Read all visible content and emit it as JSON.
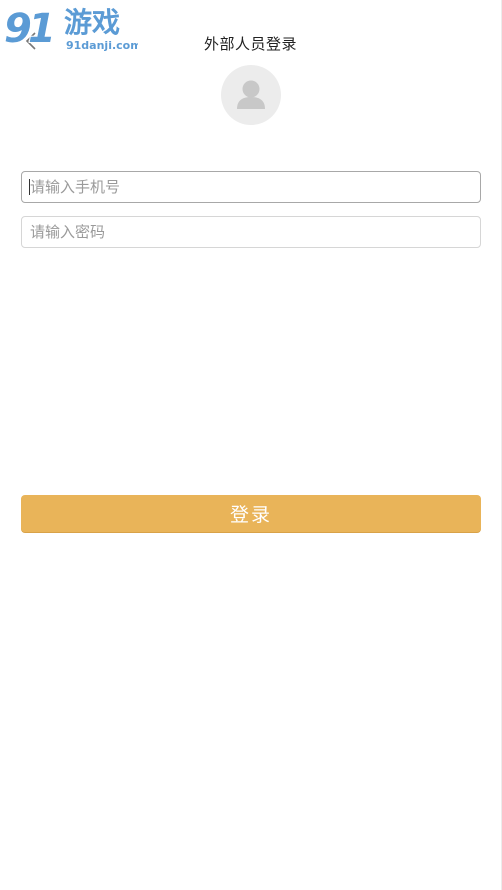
{
  "header": {
    "title": "外部人员登录",
    "back_icon": "chevron-left-icon"
  },
  "watermark": {
    "brand": "91游戏",
    "domain": "91danji.com",
    "color": "#5b9bd5"
  },
  "avatar": {
    "icon": "user-silhouette-icon",
    "bg_color": "#ececec",
    "fg_color": "#c8c8c8"
  },
  "form": {
    "phone_placeholder": "请输入手机号",
    "password_placeholder": "请输入密码",
    "login_label": "登录"
  },
  "colors": {
    "accent": "#e9b459",
    "text": "#222222",
    "placeholder": "#9a9a9a"
  }
}
